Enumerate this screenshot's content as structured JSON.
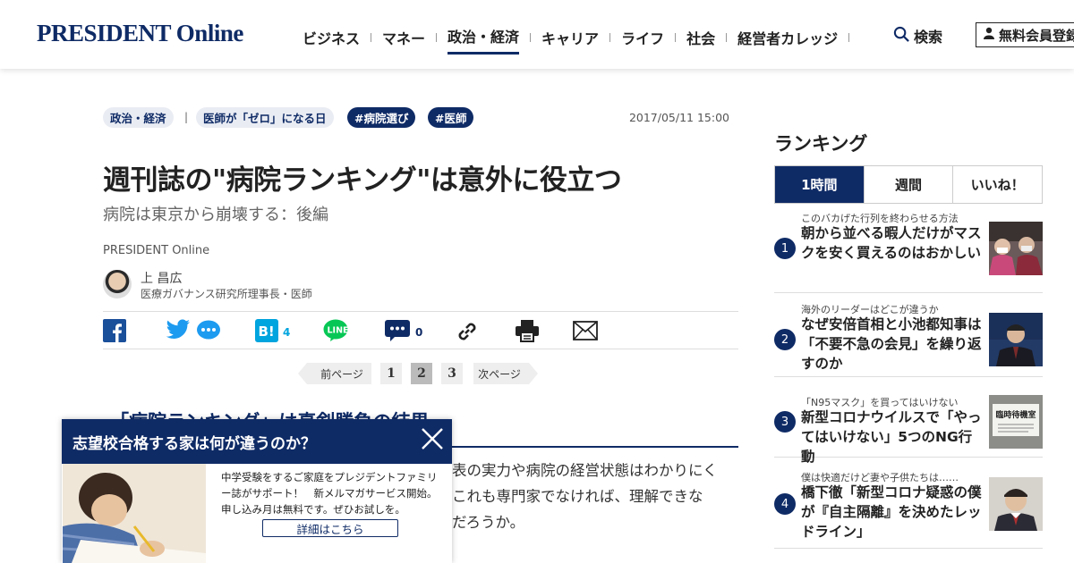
{
  "header": {
    "logo": "PRESIDENT Online",
    "nav": [
      "ビジネス",
      "マネー",
      "政治・経済",
      "キャリア",
      "ライフ",
      "社会",
      "経営者カレッジ"
    ],
    "active_nav": "政治・経済",
    "search_label": "検索",
    "register_label": "無料会員登録"
  },
  "article": {
    "category": "政治・経済",
    "series": "医師が「ゼロ」になる日",
    "hashtags": [
      "#病院選び",
      "#医師"
    ],
    "date": "2017/05/11 15:00",
    "title": "週刊誌の\"病院ランキング\"は意外に役立つ",
    "subtitle": "病院は東京から崩壊する：後編",
    "source": "PRESIDENT Online",
    "author_name": "上 昌広",
    "author_role": "医療ガバナンス研究所理事長・医師",
    "share": {
      "hatena_count": "4",
      "comment_count": "0"
    },
    "pager": {
      "prev": "前ページ",
      "pages": [
        "1",
        "2",
        "3"
      ],
      "current": "2",
      "next": "次ページ"
    },
    "section_heading": "「病院ランキング」は真剣勝負の結果",
    "body_lines": [
      "表の実力や病院の経営状態はわかりにく",
      "これも専門家でなければ、理解できな",
      "だろうか。"
    ]
  },
  "popup": {
    "title": "志望校合格する家は何が違うのか？",
    "text": "中学受験をするご家庭をプレジデントファミリー誌がサポート！　新メルマガサービス開始。申し込み月は無料です。ぜひお試しを。",
    "button": "詳細はこちら"
  },
  "ranking": {
    "title": "ランキング",
    "tabs": [
      "1時間",
      "週間",
      "いいね！"
    ],
    "active_tab": "1時間",
    "items": [
      {
        "rank": "1",
        "kicker": "このバカげた行列を終わらせる方法",
        "headline": "朝から並べる暇人だけがマスクを安く買えるのはおかしい",
        "thumb": "people-in-masks"
      },
      {
        "rank": "2",
        "kicker": "海外のリーダーはどこが違うか",
        "headline": "なぜ安倍首相と小池都知事は「不要不急の会見」を繰り返すのか",
        "thumb": "prime-minister"
      },
      {
        "rank": "3",
        "kicker": "「N95マスク」を買ってはいけない",
        "headline": "新型コロナウイルスで「やってはいけない」5つのNG行動",
        "thumb_text": "臨時待機室",
        "thumb": "waiting-room-sign"
      },
      {
        "rank": "4",
        "kicker": "僕は快適だけど妻や子供たちは……",
        "headline": "橋下徹「新型コロナ疑惑の僕が『自主隔離』を決めたレッドライン」",
        "thumb": "hashimoto-portrait"
      }
    ]
  },
  "colors": {
    "brand_navy": "#0f2b66",
    "tag_light": "#e9ecf3",
    "facebook": "#1a4f9a",
    "twitter": "#1d9bf0",
    "hatena": "#00a4de",
    "line": "#06c755"
  }
}
